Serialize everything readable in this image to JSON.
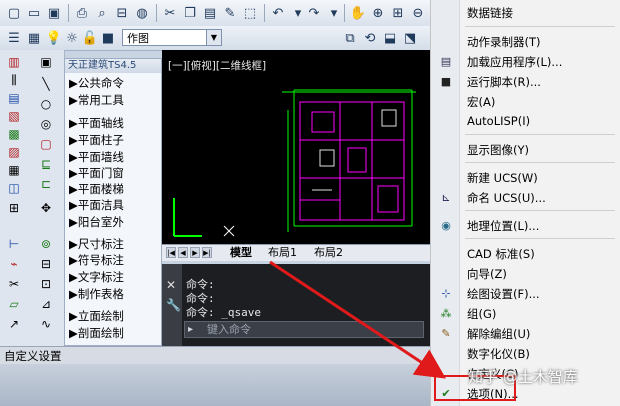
{
  "toolbar": {
    "layer_name": "作图"
  },
  "tianzheng_panel": {
    "title": "天正建筑TS4.5",
    "items": [
      "公共命令",
      "常用工具",
      "平面轴线",
      "平面柱子",
      "平面墙线",
      "平面门窗",
      "平面楼梯",
      "平面洁具",
      "阳台室外",
      "尺寸标注",
      "符号标注",
      "文字标注",
      "制作表格",
      "立面绘制",
      "剖面绘制"
    ]
  },
  "drawing": {
    "view_label": "[一][俯视][二维线框]"
  },
  "layout_tabs": {
    "tabs": [
      "模型",
      "布局1",
      "布局2"
    ]
  },
  "command_line": {
    "lines": [
      "命令:",
      "命令:",
      "命令: _qsave"
    ],
    "input_placeholder": "键入命令"
  },
  "status_bar": {
    "text": "自定义设置"
  },
  "menu": {
    "items": [
      {
        "label": "数据链接",
        "icon": ""
      },
      {
        "label": "动作录制器(T)",
        "icon": ""
      },
      {
        "label": "加载应用程序(L)...",
        "icon": "load-app-icon"
      },
      {
        "label": "运行脚本(R)...",
        "icon": "script-icon"
      },
      {
        "label": "宏(A)",
        "icon": ""
      },
      {
        "label": "AutoLISP(I)",
        "icon": ""
      },
      {
        "label": "显示图像(Y)",
        "icon": ""
      },
      {
        "label": "新建 UCS(W)",
        "icon": ""
      },
      {
        "label": "命名 UCS(U)...",
        "icon": "ucs-icon"
      },
      {
        "label": "地理位置(L)...",
        "icon": "geolocation-icon"
      },
      {
        "label": "CAD 标准(S)",
        "icon": ""
      },
      {
        "label": "向导(Z)",
        "icon": ""
      },
      {
        "label": "绘图设置(F)...",
        "icon": "drafting-settings-icon"
      },
      {
        "label": "组(G)",
        "icon": "group-icon"
      },
      {
        "label": "解除编组(U)",
        "icon": "ungroup-icon"
      },
      {
        "label": "数字化仪(B)",
        "icon": ""
      },
      {
        "label": "自定义(C)",
        "icon": ""
      },
      {
        "label": "选项(N)...",
        "icon": "options-check-icon"
      }
    ]
  },
  "watermark": "知乎 @土木智库",
  "colors": {
    "highlight_red": "#e01a1a",
    "drawing_bg": "#000000",
    "cad_magenta": "#ff00ff",
    "cad_green": "#00ff00"
  }
}
